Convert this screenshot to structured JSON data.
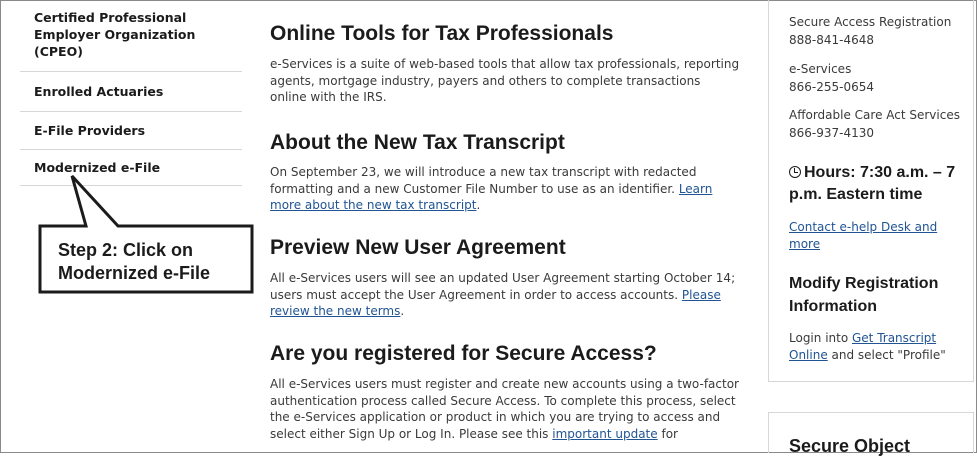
{
  "sidebar": {
    "items": [
      {
        "label": "Certified Professional Employer Organization (CPEO)"
      },
      {
        "label": "Enrolled Actuaries"
      },
      {
        "label": "E-File Providers"
      },
      {
        "label": "Modernized e-File"
      }
    ]
  },
  "callout": {
    "line1": "Step 2: Click on",
    "line2": "Modernized e-File"
  },
  "main": {
    "sections": [
      {
        "heading": "Online Tools for Tax Professionals",
        "text": "e-Services is a suite of web-based tools that allow tax professionals, reporting agents, mortgage industry, payers and others to complete transactions online with the IRS."
      },
      {
        "heading": "About the New Tax Transcript",
        "text": "On September 23, we will introduce a new tax transcript with redacted formatting and a new Customer File Number to use as an identifier.",
        "link": "Learn more about the new tax transcript",
        "after": "."
      },
      {
        "heading": "Preview New User Agreement",
        "text": "All e-Services users will see an updated User Agreement starting October 14; users must accept the User Agreement in order to access accounts.",
        "link": "Please review the new terms",
        "after": "."
      },
      {
        "heading": "Are you registered for Secure Access?",
        "text": "All e-Services users must register and create new accounts using a two-factor authentication process called Secure Access. To complete this process, select the e-Services application or product in which you are trying to access and select either Sign Up or Log In. Please see this",
        "link": "important update",
        "after": " for"
      }
    ]
  },
  "right": {
    "contacts": [
      {
        "name": "Secure Access Registration",
        "phone": "888-841-4648"
      },
      {
        "name": "e-Services",
        "phone": "866-255-0654"
      },
      {
        "name": "Affordable Care Act Services",
        "phone": "866-937-4130"
      }
    ],
    "hours_line1": "Hours: 7:30 a.m. – 7",
    "hours_line2": "p.m. Eastern time",
    "contact_link_1": "Contact e-help Desk and",
    "contact_link_2": "more",
    "modify_heading_1": "Modify Registration",
    "modify_heading_2": "Information",
    "login_prefix": "Login into ",
    "login_link_1": "Get Transcript",
    "login_link_2": "Online",
    "login_suffix": " and select \"Profile\"",
    "secure_object_heading": "Secure Object"
  },
  "colors": {
    "link": "#205493",
    "divider": "#d6d7d9",
    "text": "#1b1b1b"
  }
}
